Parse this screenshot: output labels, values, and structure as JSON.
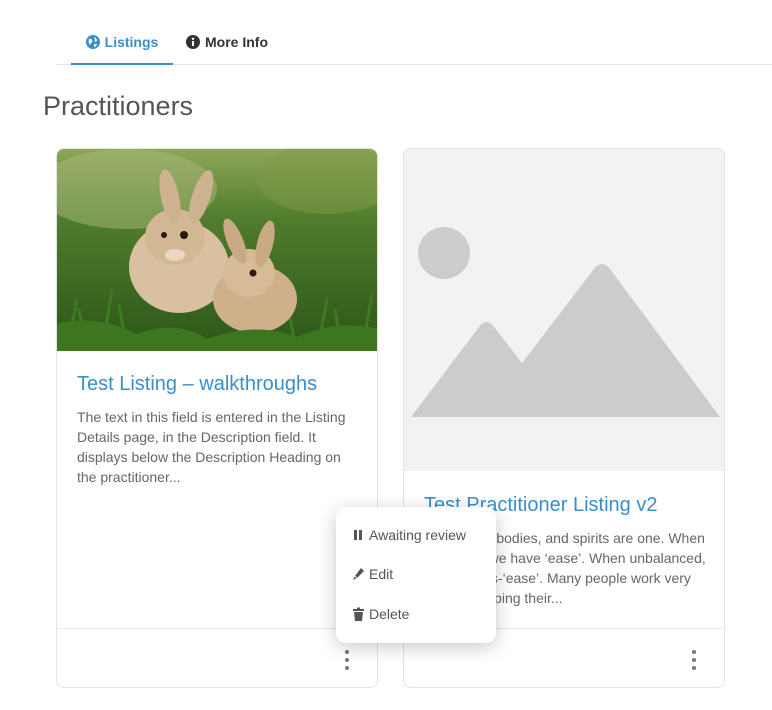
{
  "tabs": [
    {
      "label": "Listings",
      "icon": "globe-icon",
      "active": true
    },
    {
      "label": "More Info",
      "icon": "info-circle-icon",
      "active": false
    }
  ],
  "section": {
    "title": "Practitioners"
  },
  "cards": [
    {
      "title": "Test Listing – walkthroughs",
      "description": "The text in this field is entered in the Listing Details page, in the Description field. It displays below the Description Heading on the practitioner...",
      "image": "rabbits-photo"
    },
    {
      "title": "Test Practitioner Listing v2",
      "description": "Our minds, bodies, and spirits are one. When balanced, we have ‘ease’. When unbalanced, we have dis-‘ease’. Many people work very hard at keeping their...",
      "image": "image-placeholder-icon"
    }
  ],
  "menu": {
    "items": [
      {
        "label": "Awaiting review",
        "icon": "pause-icon"
      },
      {
        "label": "Edit",
        "icon": "pencil-icon"
      },
      {
        "label": "Delete",
        "icon": "trash-icon"
      }
    ]
  },
  "colors": {
    "accent": "#3a8fc8",
    "text": "#555555",
    "placeholder": "#cccccc"
  }
}
